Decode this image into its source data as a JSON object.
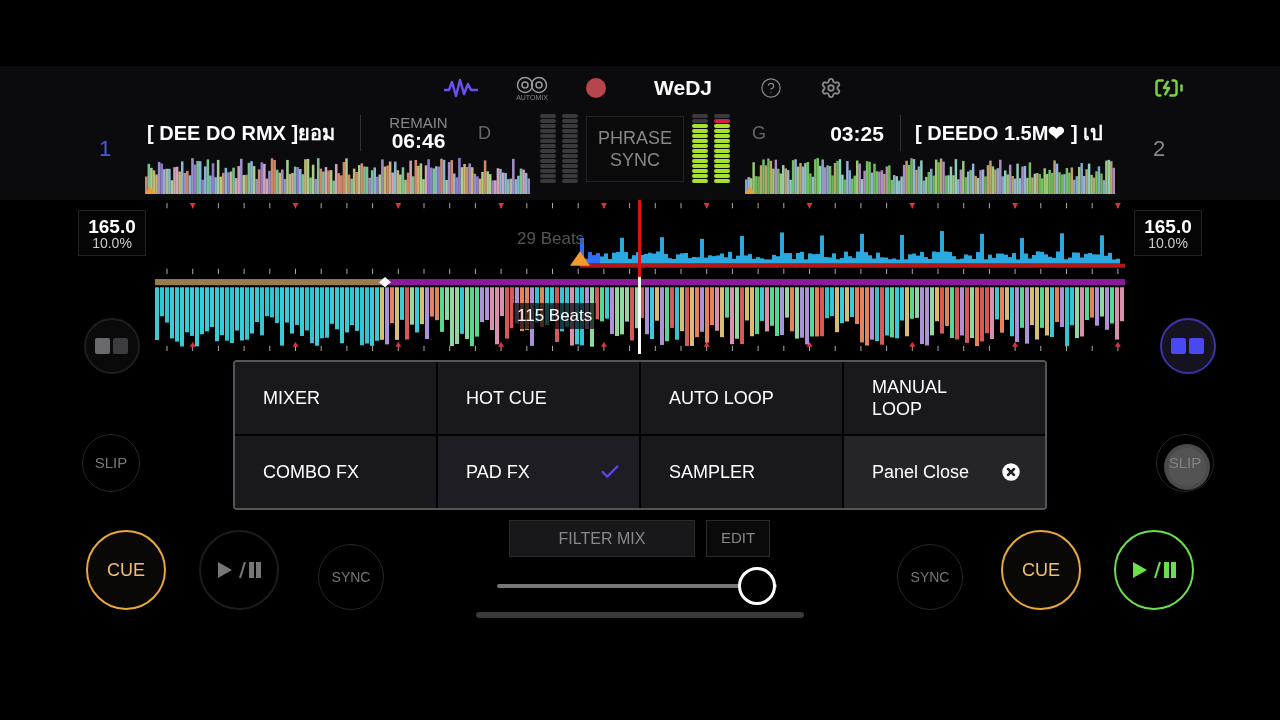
{
  "top_bar": {
    "automix_label": "AUTOMIX",
    "brand": "WeDJ"
  },
  "decks": [
    {
      "number": "1",
      "selected": true,
      "title": "[ DEE DO RMX ]ยอม",
      "remain_label": "REMAIN",
      "time": "06:46",
      "key": "D",
      "bpm": "165.0",
      "pitch": "10.0%",
      "pad_mode_active": false,
      "slip": "SLIP",
      "cue": "CUE",
      "sync": "SYNC",
      "playing": false
    },
    {
      "number": "2",
      "selected": false,
      "title": "[ DEEDO 1.5M❤ ] เป",
      "time": "03:25",
      "key": "G",
      "bpm": "165.0",
      "pitch": "10.0%",
      "pad_mode_active": true,
      "slip": "SLIP",
      "cue": "CUE",
      "sync": "SYNC",
      "playing": true,
      "meters": [
        {
          "level": 0.86
        },
        {
          "level": 0.93
        }
      ]
    }
  ],
  "phrase_sync": "PHRASE SYNC",
  "waveforms": [
    {
      "beats": "29 Beats"
    },
    {
      "beats": "115 Beats"
    }
  ],
  "panel": {
    "items": [
      {
        "label": "MIXER",
        "kind": "mode",
        "selected": false
      },
      {
        "label": "HOT CUE",
        "kind": "mode",
        "selected": false
      },
      {
        "label": "AUTO LOOP",
        "kind": "mode",
        "selected": false
      },
      {
        "label": "MANUAL LOOP",
        "kind": "mode",
        "selected": false
      },
      {
        "label": "COMBO FX",
        "kind": "mode",
        "selected": false
      },
      {
        "label": "PAD FX",
        "kind": "mode",
        "selected": true
      },
      {
        "label": "SAMPLER",
        "kind": "mode",
        "selected": false
      },
      {
        "label": "Panel Close",
        "kind": "close"
      }
    ]
  },
  "filter": {
    "label": "FILTER MIX",
    "edit": "EDIT",
    "level": 0.93
  }
}
